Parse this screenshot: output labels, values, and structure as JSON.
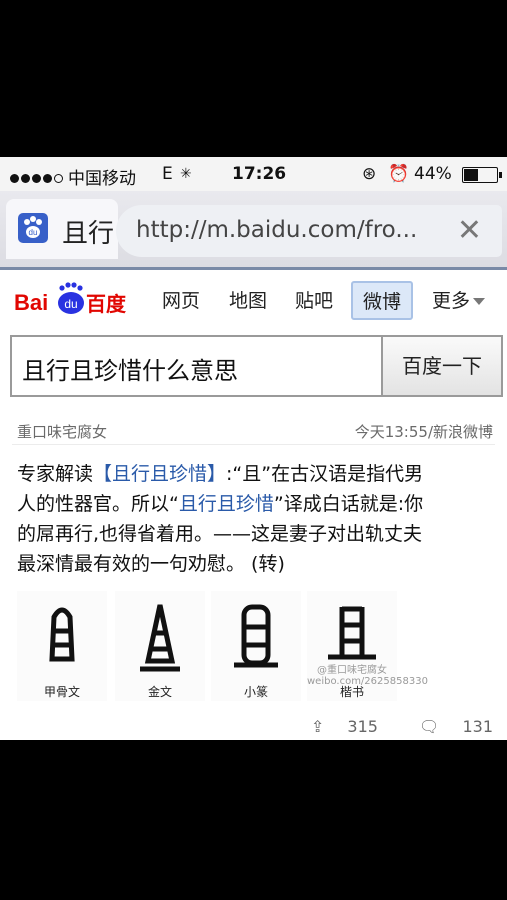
{
  "status": {
    "carrier": "中国移动",
    "network": "E",
    "time": "17:26",
    "battery": "44%"
  },
  "browser": {
    "tab_title": "且行",
    "url": "http://m.baidu.com/fro...",
    "close": "✕"
  },
  "baidu": {
    "logo_text": "Bai du 百度",
    "nav": [
      "网页",
      "地图",
      "贴吧",
      "微博",
      "更多"
    ],
    "active_nav": "微博",
    "query": "且行且珍惜什么意思",
    "search_button": "百度一下"
  },
  "post": {
    "author": "重口味宅腐女",
    "time": "今天13:55",
    "source": "/新浪微博",
    "body_lines": [
      "专家解读【且行且珍惜】:“且”在古汉语是指代男",
      "人的性器官。所以“且行且珍惜”译成白话就是:你",
      "的屌再行,也得省着用。——这是妻子对出轨丈夫",
      "最深情最有效的一句劝慰。 (转)"
    ],
    "images": [
      {
        "caption": "甲骨文",
        "glyph": "oracle"
      },
      {
        "caption": "金文",
        "glyph": "bronze"
      },
      {
        "caption": "小篆",
        "glyph": "seal"
      },
      {
        "caption": "楷书",
        "glyph": "regular",
        "watermark": "@重口味宅腐女 weibo.com/2625858330"
      }
    ],
    "reposts": "315",
    "comments": "131"
  }
}
